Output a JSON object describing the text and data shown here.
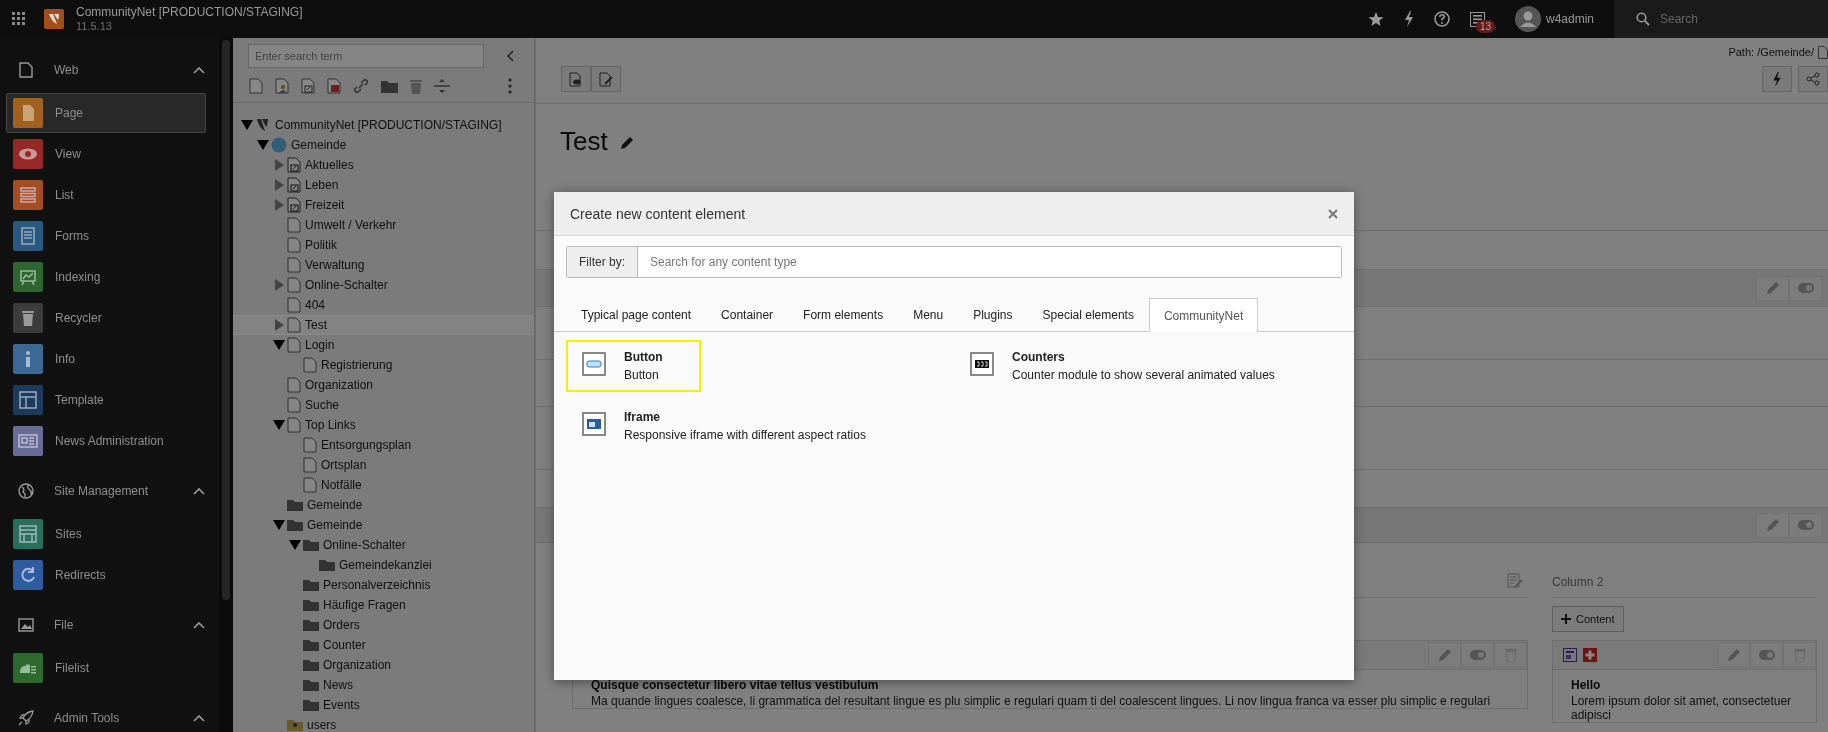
{
  "topbar": {
    "site_title": "CommunityNet [PRODUCTION/STAGING]",
    "version": "11.5.13",
    "notification_count": "13",
    "username": "w4admin",
    "search": {
      "placeholder": "Search"
    }
  },
  "modules": [
    {
      "label": "Web",
      "kind": "web",
      "expanded": true,
      "items": [
        {
          "label": "Page",
          "kind": "page",
          "color": "#a3611f",
          "selected": true
        },
        {
          "label": "View",
          "kind": "view",
          "color": "#962828",
          "selected": false
        },
        {
          "label": "List",
          "kind": "list",
          "color": "#a24d24",
          "selected": false
        },
        {
          "label": "Forms",
          "kind": "forms",
          "color": "#2b5880",
          "selected": false
        },
        {
          "label": "Indexing",
          "kind": "indexing",
          "color": "#2f6530",
          "selected": false
        },
        {
          "label": "Recycler",
          "kind": "recycler",
          "color": "#3c3c3c",
          "selected": false
        },
        {
          "label": "Info",
          "kind": "info",
          "color": "#3c6894",
          "selected": false
        },
        {
          "label": "Template",
          "kind": "template",
          "color": "#1c3b5e",
          "selected": false
        },
        {
          "label": "News Administration",
          "kind": "news",
          "color": "#666c96",
          "selected": false
        }
      ]
    },
    {
      "label": "Site Management",
      "kind": "site",
      "expanded": true,
      "items": [
        {
          "label": "Sites",
          "kind": "sites",
          "color": "#2c6e5c",
          "selected": false
        },
        {
          "label": "Redirects",
          "kind": "redirects",
          "color": "#2f5c9e",
          "selected": false
        }
      ]
    },
    {
      "label": "File",
      "kind": "file",
      "expanded": true,
      "items": [
        {
          "label": "Filelist",
          "kind": "filelist",
          "color": "#2e6a2e",
          "selected": false
        }
      ]
    },
    {
      "label": "Admin Tools",
      "kind": "admin",
      "expanded": true
    }
  ],
  "page_tree": {
    "search": {
      "placeholder": "Enter search term"
    },
    "nodes": [
      {
        "label": "CommunityNet [PRODUCTION/STAGING]",
        "kind": "root",
        "expanded": true,
        "selected": false,
        "children": [
          {
            "label": "Gemeinde",
            "kind": "site",
            "expanded": true,
            "selected": false,
            "children": [
              {
                "label": "Aktuelles",
                "kind": "shortcut",
                "expanded": false,
                "selected": false
              },
              {
                "label": "Leben",
                "kind": "shortcut",
                "expanded": false,
                "selected": false
              },
              {
                "label": "Freizeit",
                "kind": "shortcut",
                "expanded": false,
                "selected": false
              },
              {
                "label": "Umwelt / Verkehr",
                "kind": "page",
                "selected": false
              },
              {
                "label": "Politik",
                "kind": "page",
                "selected": false
              },
              {
                "label": "Verwaltung",
                "kind": "page",
                "selected": false
              },
              {
                "label": "Online-Schalter",
                "kind": "page",
                "expanded": false,
                "selected": false
              },
              {
                "label": "404",
                "kind": "page",
                "selected": false
              },
              {
                "label": "Test",
                "kind": "page",
                "expanded": false,
                "selected": true
              },
              {
                "label": "Login",
                "kind": "page",
                "expanded": true,
                "selected": false,
                "children": [
                  {
                    "label": "Registrierung",
                    "kind": "page",
                    "selected": false
                  }
                ]
              },
              {
                "label": "Organization",
                "kind": "page",
                "selected": false
              },
              {
                "label": "Suche",
                "kind": "page",
                "selected": false
              },
              {
                "label": "Top Links",
                "kind": "page",
                "expanded": true,
                "selected": false,
                "children": [
                  {
                    "label": "Entsorgungsplan",
                    "kind": "page",
                    "selected": false
                  },
                  {
                    "label": "Ortsplan",
                    "kind": "page",
                    "selected": false
                  },
                  {
                    "label": "Notfälle",
                    "kind": "page",
                    "selected": false
                  }
                ]
              },
              {
                "label": "Gemeinde",
                "kind": "folder",
                "selected": false
              },
              {
                "label": "Gemeinde",
                "kind": "folder",
                "expanded": true,
                "selected": false,
                "children": [
                  {
                    "label": "Online-Schalter",
                    "kind": "folder",
                    "expanded": true,
                    "selected": false,
                    "children": [
                      {
                        "label": "Gemeindekanzlei",
                        "kind": "folder",
                        "selected": false
                      }
                    ]
                  },
                  {
                    "label": "Personalverzeichnis",
                    "kind": "folder",
                    "selected": false
                  },
                  {
                    "label": "Häufige Fragen",
                    "kind": "folder",
                    "selected": false
                  },
                  {
                    "label": "Orders",
                    "kind": "folder",
                    "selected": false
                  },
                  {
                    "label": "Counter",
                    "kind": "folder",
                    "selected": false
                  },
                  {
                    "label": "Organization",
                    "kind": "folder",
                    "selected": false
                  },
                  {
                    "label": "News",
                    "kind": "folder",
                    "selected": false
                  },
                  {
                    "label": "Events",
                    "kind": "folder",
                    "selected": false
                  }
                ]
              },
              {
                "label": "users",
                "kind": "users",
                "selected": false
              }
            ]
          }
        ]
      }
    ]
  },
  "content": {
    "path": "Path: /Gemeinde/",
    "page_title": "Test",
    "column_title": "Column 2",
    "add_button": "Content",
    "cards": [
      {
        "heading": "Quisque consectetur libero vitae tellus vestibulum",
        "text": "Ma quande lingues coalesce, li grammatica del resultant lingue es plu simplic e regulari quam ti del coalescent lingues. Li nov lingua franca va esser plu simplic e regulari"
      },
      {
        "heading": "Hello",
        "text": "Lorem ipsum dolor sit amet, consectetuer adipisci"
      }
    ]
  },
  "modal": {
    "title": "Create new content element",
    "filter": {
      "label": "Filter by:",
      "placeholder": "Search for any content type"
    },
    "tabs": [
      {
        "label": "Typical page content",
        "selected": false
      },
      {
        "label": "Container",
        "selected": false
      },
      {
        "label": "Form elements",
        "selected": false
      },
      {
        "label": "Menu",
        "selected": false
      },
      {
        "label": "Plugins",
        "selected": false
      },
      {
        "label": "Special elements",
        "selected": false
      },
      {
        "label": "CommunityNet",
        "selected": true
      }
    ],
    "items": [
      {
        "title": "Button",
        "description": "Button",
        "kind": "button",
        "selected": true
      },
      {
        "title": "Counters",
        "description": "Counter module to show several animated values",
        "kind": "counter",
        "selected": false
      },
      {
        "title": "Iframe",
        "description": "Responsive iframe with different aspect ratios",
        "kind": "iframe",
        "selected": false
      }
    ]
  }
}
